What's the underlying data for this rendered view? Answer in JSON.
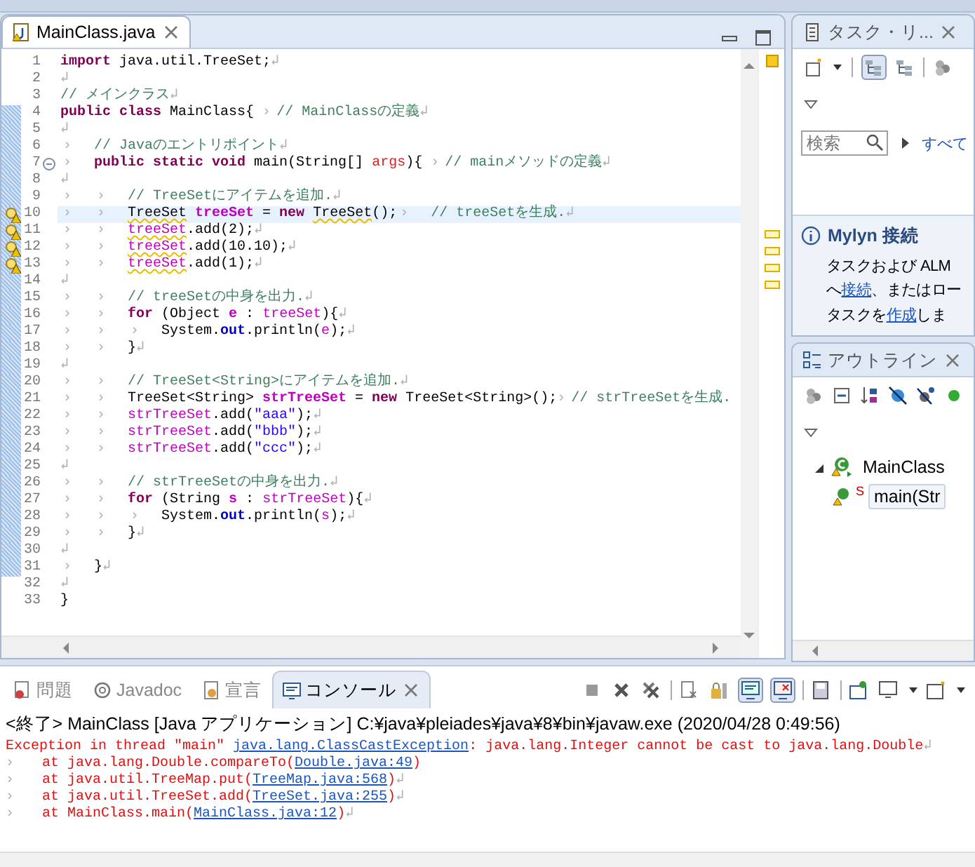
{
  "editor": {
    "tab": {
      "title": "MainClass.java",
      "selected": true
    },
    "lines": [
      {
        "no": "1",
        "changed": false,
        "warning": false,
        "current": false,
        "fold": false,
        "tokens": [
          {
            "kind": "keyword",
            "text": "import"
          },
          {
            "kind": "plain",
            "text": " java.util.TreeSet;"
          },
          {
            "kind": "eol",
            "text": "↲"
          }
        ]
      },
      {
        "no": "2",
        "changed": false,
        "warning": false,
        "current": false,
        "fold": false,
        "tokens": [
          {
            "kind": "eol",
            "text": "↲"
          }
        ]
      },
      {
        "no": "3",
        "changed": false,
        "warning": false,
        "current": false,
        "fold": false,
        "tokens": [
          {
            "kind": "comment",
            "text": "// メインクラス"
          },
          {
            "kind": "eol",
            "text": "↲"
          }
        ]
      },
      {
        "no": "4",
        "changed": true,
        "warning": false,
        "current": false,
        "fold": false,
        "tokens": [
          {
            "kind": "keyword",
            "text": "public "
          },
          {
            "kind": "keyword",
            "text": "class"
          },
          {
            "kind": "plain",
            "text": " MainClass{ "
          },
          {
            "kind": "gap",
            "text": "›"
          },
          {
            "kind": "comment",
            "text": "// MainClassの定義"
          },
          {
            "kind": "eol",
            "text": "↲"
          }
        ]
      },
      {
        "no": "5",
        "changed": true,
        "warning": false,
        "current": false,
        "fold": false,
        "tokens": [
          {
            "kind": "eol",
            "text": "↲"
          }
        ]
      },
      {
        "no": "6",
        "changed": true,
        "warning": false,
        "current": false,
        "fold": false,
        "tokens": [
          {
            "kind": "tab",
            "text": "›"
          },
          {
            "kind": "comment",
            "text": "// Javaのエントリポイント"
          },
          {
            "kind": "eol",
            "text": "↲"
          }
        ]
      },
      {
        "no": "7",
        "changed": true,
        "warning": false,
        "current": false,
        "fold": true,
        "tokens": [
          {
            "kind": "tab",
            "text": "›"
          },
          {
            "kind": "keyword",
            "text": "public "
          },
          {
            "kind": "keyword",
            "text": "static "
          },
          {
            "kind": "keyword",
            "text": "void"
          },
          {
            "kind": "plain",
            "text": " main(String[] "
          },
          {
            "kind": "parameter",
            "text": "args"
          },
          {
            "kind": "plain",
            "text": "){ "
          },
          {
            "kind": "gap",
            "text": "›"
          },
          {
            "kind": "comment",
            "text": "// mainメソッドの定義"
          },
          {
            "kind": "eol",
            "text": "↲"
          }
        ]
      },
      {
        "no": "8",
        "changed": true,
        "warning": false,
        "current": false,
        "fold": false,
        "tokens": [
          {
            "kind": "eol",
            "text": "↲"
          }
        ]
      },
      {
        "no": "9",
        "changed": true,
        "warning": false,
        "current": false,
        "fold": false,
        "tokens": [
          {
            "kind": "tab",
            "text": "›"
          },
          {
            "kind": "tab",
            "text": "›"
          },
          {
            "kind": "comment",
            "text": "// TreeSetにアイテムを追加."
          },
          {
            "kind": "eol",
            "text": "↲"
          }
        ]
      },
      {
        "no": "10",
        "changed": true,
        "warning": true,
        "current": true,
        "fold": false,
        "tokens": [
          {
            "kind": "tab",
            "text": "›"
          },
          {
            "kind": "tab",
            "text": "›"
          },
          {
            "kind": "plain",
            "text": "TreeSet",
            "warning_underline": true
          },
          {
            "kind": "declaration",
            "text": " treeSet"
          },
          {
            "kind": "plain",
            "text": " = "
          },
          {
            "kind": "keyword",
            "text": "new "
          },
          {
            "kind": "plain",
            "text": "TreeSet",
            "warning_underline": true
          },
          {
            "kind": "plain",
            "text": "();"
          },
          {
            "kind": "tab",
            "text": "›"
          },
          {
            "kind": "comment",
            "text": "// treeSetを生成."
          },
          {
            "kind": "eol",
            "text": "↲"
          }
        ]
      },
      {
        "no": "11",
        "changed": true,
        "warning": true,
        "current": false,
        "fold": false,
        "tokens": [
          {
            "kind": "tab",
            "text": "›"
          },
          {
            "kind": "tab",
            "text": "›"
          },
          {
            "kind": "variable",
            "text": "treeSet",
            "warning_underline": true
          },
          {
            "kind": "plain",
            "text": ".add(2);"
          },
          {
            "kind": "eol",
            "text": "↲"
          }
        ]
      },
      {
        "no": "12",
        "changed": true,
        "warning": true,
        "current": false,
        "fold": false,
        "tokens": [
          {
            "kind": "tab",
            "text": "›"
          },
          {
            "kind": "tab",
            "text": "›"
          },
          {
            "kind": "variable",
            "text": "treeSet",
            "warning_underline": true
          },
          {
            "kind": "plain",
            "text": ".add(10.10);"
          },
          {
            "kind": "eol",
            "text": "↲"
          }
        ]
      },
      {
        "no": "13",
        "changed": true,
        "warning": true,
        "current": false,
        "fold": false,
        "tokens": [
          {
            "kind": "tab",
            "text": "›"
          },
          {
            "kind": "tab",
            "text": "›"
          },
          {
            "kind": "variable",
            "text": "treeSet",
            "warning_underline": true
          },
          {
            "kind": "plain",
            "text": ".add(1);"
          },
          {
            "kind": "eol",
            "text": "↲"
          }
        ]
      },
      {
        "no": "14",
        "changed": true,
        "warning": false,
        "current": false,
        "fold": false,
        "tokens": [
          {
            "kind": "eol",
            "text": "↲"
          }
        ]
      },
      {
        "no": "15",
        "changed": true,
        "warning": false,
        "current": false,
        "fold": false,
        "tokens": [
          {
            "kind": "tab",
            "text": "›"
          },
          {
            "kind": "tab",
            "text": "›"
          },
          {
            "kind": "comment",
            "text": "// treeSetの中身を出力."
          },
          {
            "kind": "eol",
            "text": "↲"
          }
        ]
      },
      {
        "no": "16",
        "changed": true,
        "warning": false,
        "current": false,
        "fold": false,
        "tokens": [
          {
            "kind": "tab",
            "text": "›"
          },
          {
            "kind": "tab",
            "text": "›"
          },
          {
            "kind": "keyword",
            "text": "for"
          },
          {
            "kind": "plain",
            "text": " (Object "
          },
          {
            "kind": "declaration",
            "text": "e"
          },
          {
            "kind": "plain",
            "text": " : "
          },
          {
            "kind": "variable",
            "text": "treeSet"
          },
          {
            "kind": "plain",
            "text": "){"
          },
          {
            "kind": "eol",
            "text": "↲"
          }
        ]
      },
      {
        "no": "17",
        "changed": true,
        "warning": false,
        "current": false,
        "fold": false,
        "tokens": [
          {
            "kind": "tab",
            "text": "›"
          },
          {
            "kind": "tab",
            "text": "›"
          },
          {
            "kind": "tab",
            "text": "›"
          },
          {
            "kind": "plain",
            "text": "System."
          },
          {
            "kind": "static",
            "text": "out"
          },
          {
            "kind": "plain",
            "text": ".println("
          },
          {
            "kind": "variable",
            "text": "e"
          },
          {
            "kind": "plain",
            "text": ");"
          },
          {
            "kind": "eol",
            "text": "↲"
          }
        ]
      },
      {
        "no": "18",
        "changed": true,
        "warning": false,
        "current": false,
        "fold": false,
        "tokens": [
          {
            "kind": "tab",
            "text": "›"
          },
          {
            "kind": "tab",
            "text": "›"
          },
          {
            "kind": "plain",
            "text": "}"
          },
          {
            "kind": "eol",
            "text": "↲"
          }
        ]
      },
      {
        "no": "19",
        "changed": true,
        "warning": false,
        "current": false,
        "fold": false,
        "tokens": [
          {
            "kind": "eol",
            "text": "↲"
          }
        ]
      },
      {
        "no": "20",
        "changed": true,
        "warning": false,
        "current": false,
        "fold": false,
        "tokens": [
          {
            "kind": "tab",
            "text": "›"
          },
          {
            "kind": "tab",
            "text": "›"
          },
          {
            "kind": "comment",
            "text": "// TreeSet<String>にアイテムを追加."
          },
          {
            "kind": "eol",
            "text": "↲"
          }
        ]
      },
      {
        "no": "21",
        "changed": true,
        "warning": false,
        "current": false,
        "fold": false,
        "tokens": [
          {
            "kind": "tab",
            "text": "›"
          },
          {
            "kind": "tab",
            "text": "›"
          },
          {
            "kind": "plain",
            "text": "TreeSet<String> "
          },
          {
            "kind": "declaration",
            "text": "strTreeSet"
          },
          {
            "kind": "plain",
            "text": " = "
          },
          {
            "kind": "keyword",
            "text": "new"
          },
          {
            "kind": "plain",
            "text": " TreeSet<String>();"
          },
          {
            "kind": "gap",
            "text": "›"
          },
          {
            "kind": "comment",
            "text": "// strTreeSetを生成."
          }
        ]
      },
      {
        "no": "22",
        "changed": true,
        "warning": false,
        "current": false,
        "fold": false,
        "tokens": [
          {
            "kind": "tab",
            "text": "›"
          },
          {
            "kind": "tab",
            "text": "›"
          },
          {
            "kind": "variable",
            "text": "strTreeSet"
          },
          {
            "kind": "plain",
            "text": ".add("
          },
          {
            "kind": "string",
            "text": "\"aaa\""
          },
          {
            "kind": "plain",
            "text": ");"
          },
          {
            "kind": "eol",
            "text": "↲"
          }
        ]
      },
      {
        "no": "23",
        "changed": true,
        "warning": false,
        "current": false,
        "fold": false,
        "tokens": [
          {
            "kind": "tab",
            "text": "›"
          },
          {
            "kind": "tab",
            "text": "›"
          },
          {
            "kind": "variable",
            "text": "strTreeSet"
          },
          {
            "kind": "plain",
            "text": ".add("
          },
          {
            "kind": "string",
            "text": "\"bbb\""
          },
          {
            "kind": "plain",
            "text": ");"
          },
          {
            "kind": "eol",
            "text": "↲"
          }
        ]
      },
      {
        "no": "24",
        "changed": true,
        "warning": false,
        "current": false,
        "fold": false,
        "tokens": [
          {
            "kind": "tab",
            "text": "›"
          },
          {
            "kind": "tab",
            "text": "›"
          },
          {
            "kind": "variable",
            "text": "strTreeSet"
          },
          {
            "kind": "plain",
            "text": ".add("
          },
          {
            "kind": "string",
            "text": "\"ccc\""
          },
          {
            "kind": "plain",
            "text": ");"
          },
          {
            "kind": "eol",
            "text": "↲"
          }
        ]
      },
      {
        "no": "25",
        "changed": true,
        "warning": false,
        "current": false,
        "fold": false,
        "tokens": [
          {
            "kind": "eol",
            "text": "↲"
          }
        ]
      },
      {
        "no": "26",
        "changed": true,
        "warning": false,
        "current": false,
        "fold": false,
        "tokens": [
          {
            "kind": "tab",
            "text": "›"
          },
          {
            "kind": "tab",
            "text": "›"
          },
          {
            "kind": "comment",
            "text": "// strTreeSetの中身を出力."
          },
          {
            "kind": "eol",
            "text": "↲"
          }
        ]
      },
      {
        "no": "27",
        "changed": true,
        "warning": false,
        "current": false,
        "fold": false,
        "tokens": [
          {
            "kind": "tab",
            "text": "›"
          },
          {
            "kind": "tab",
            "text": "›"
          },
          {
            "kind": "keyword",
            "text": "for"
          },
          {
            "kind": "plain",
            "text": " (String "
          },
          {
            "kind": "declaration",
            "text": "s"
          },
          {
            "kind": "plain",
            "text": " : "
          },
          {
            "kind": "variable",
            "text": "strTreeSet"
          },
          {
            "kind": "plain",
            "text": "){"
          },
          {
            "kind": "eol",
            "text": "↲"
          }
        ]
      },
      {
        "no": "28",
        "changed": true,
        "warning": false,
        "current": false,
        "fold": false,
        "tokens": [
          {
            "kind": "tab",
            "text": "›"
          },
          {
            "kind": "tab",
            "text": "›"
          },
          {
            "kind": "tab",
            "text": "›"
          },
          {
            "kind": "plain",
            "text": "System."
          },
          {
            "kind": "static",
            "text": "out"
          },
          {
            "kind": "plain",
            "text": ".println("
          },
          {
            "kind": "variable",
            "text": "s"
          },
          {
            "kind": "plain",
            "text": ");"
          },
          {
            "kind": "eol",
            "text": "↲"
          }
        ]
      },
      {
        "no": "29",
        "changed": true,
        "warning": false,
        "current": false,
        "fold": false,
        "tokens": [
          {
            "kind": "tab",
            "text": "›"
          },
          {
            "kind": "tab",
            "text": "›"
          },
          {
            "kind": "plain",
            "text": "}"
          },
          {
            "kind": "eol",
            "text": "↲"
          }
        ]
      },
      {
        "no": "30",
        "changed": true,
        "warning": false,
        "current": false,
        "fold": false,
        "tokens": [
          {
            "kind": "eol",
            "text": "↲"
          }
        ]
      },
      {
        "no": "31",
        "changed": true,
        "warning": false,
        "current": false,
        "fold": false,
        "tokens": [
          {
            "kind": "tab",
            "text": "›"
          },
          {
            "kind": "plain",
            "text": "}"
          },
          {
            "kind": "eol",
            "text": "↲"
          }
        ]
      },
      {
        "no": "32",
        "changed": false,
        "warning": false,
        "current": false,
        "fold": false,
        "tokens": [
          {
            "kind": "eol",
            "text": "↲"
          }
        ]
      },
      {
        "no": "33",
        "changed": false,
        "warning": false,
        "current": false,
        "fold": false,
        "tokens": [
          {
            "kind": "plain",
            "text": "}"
          }
        ]
      }
    ]
  },
  "task_panel": {
    "tab": {
      "title": "タスク・リ...",
      "selected": false
    },
    "search_placeholder": "検索",
    "filter_link": "すべて",
    "mylyn": {
      "title": "Mylyn 接続",
      "lines": [
        [
          {
            "text": "タスクおよび ALM",
            "link": false
          }
        ],
        [
          {
            "text": "へ",
            "link": false
          },
          {
            "text": "接続",
            "link": true
          },
          {
            "text": "、またはロー",
            "link": false
          }
        ],
        [
          {
            "text": "タスクを",
            "link": false
          },
          {
            "text": "作成",
            "link": true
          },
          {
            "text": "しま",
            "link": false
          }
        ]
      ]
    }
  },
  "outline": {
    "tab": {
      "title": "アウトライン",
      "selected": false
    },
    "tree": [
      {
        "label": "MainClass",
        "expanded": true,
        "selected": false,
        "children": [
          {
            "label": "main(Str",
            "static_mark": "S",
            "selected": true
          }
        ]
      }
    ]
  },
  "console": {
    "tabs": [
      {
        "label": "問題",
        "selected": false,
        "kind": "problems"
      },
      {
        "label": "Javadoc",
        "selected": false,
        "kind": "javadoc"
      },
      {
        "label": "宣言",
        "selected": false,
        "kind": "declaration"
      },
      {
        "label": "コンソール",
        "selected": true,
        "kind": "console"
      }
    ],
    "header": "<終了> MainClass [Java アプリケーション] C:¥java¥pleiades¥java¥8¥bin¥javaw.exe (2020/04/28 0:49:56)",
    "lines": [
      [
        {
          "kind": "error",
          "text": "Exception in thread \"main\" "
        },
        {
          "kind": "link",
          "text": "java.lang.ClassCastException"
        },
        {
          "kind": "error",
          "text": ": java.lang.Integer cannot be cast to java.lang.Double"
        },
        {
          "kind": "eol",
          "text": "↲"
        }
      ],
      [
        {
          "kind": "tab",
          "text": "›"
        },
        {
          "kind": "error",
          "text": "at java.lang.Double.compareTo("
        },
        {
          "kind": "link",
          "text": "Double.java:49"
        },
        {
          "kind": "error",
          "text": ")"
        }
      ],
      [
        {
          "kind": "tab",
          "text": "›"
        },
        {
          "kind": "error",
          "text": "at java.util.TreeMap.put("
        },
        {
          "kind": "link",
          "text": "TreeMap.java:568"
        },
        {
          "kind": "error",
          "text": ")"
        },
        {
          "kind": "eol",
          "text": "↲"
        }
      ],
      [
        {
          "kind": "tab",
          "text": "›"
        },
        {
          "kind": "error",
          "text": "at java.util.TreeSet.add("
        },
        {
          "kind": "link",
          "text": "TreeSet.java:255"
        },
        {
          "kind": "error",
          "text": ")"
        },
        {
          "kind": "eol",
          "text": "↲"
        }
      ],
      [
        {
          "kind": "tab",
          "text": "›"
        },
        {
          "kind": "error",
          "text": "at MainClass.main("
        },
        {
          "kind": "link",
          "text": "MainClass.java:12"
        },
        {
          "kind": "error",
          "text": ")"
        },
        {
          "kind": "eol",
          "text": "↲"
        }
      ]
    ]
  }
}
